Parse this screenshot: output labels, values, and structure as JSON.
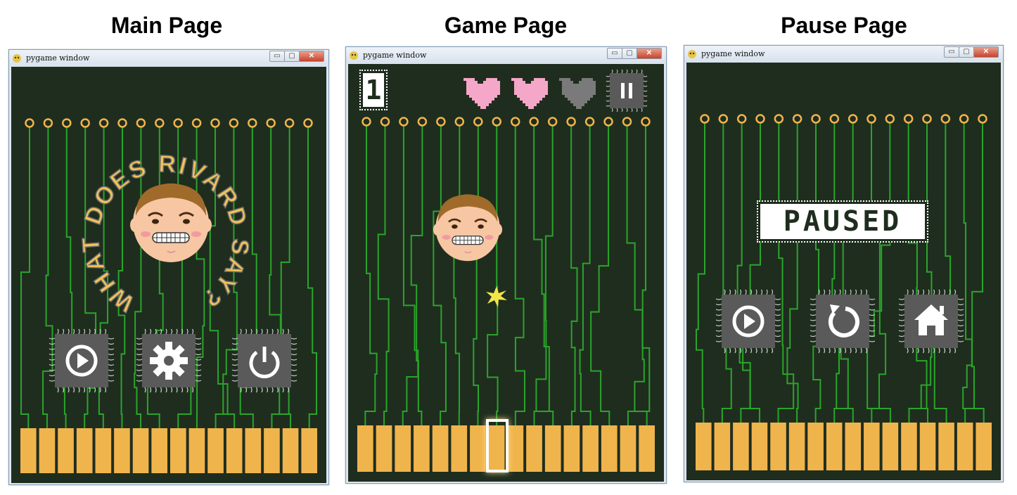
{
  "panels": [
    {
      "heading": "Main Page"
    },
    {
      "heading": "Game Page"
    },
    {
      "heading": "Pause Page"
    }
  ],
  "window": {
    "title": "pygame window",
    "minimize": "▭",
    "maximize": "▢",
    "close": "✕"
  },
  "main": {
    "title_arc": "WHAT DOES RIVARD SAY?",
    "buttons": [
      {
        "name": "play",
        "icon": "play-icon"
      },
      {
        "name": "settings",
        "icon": "gear-icon"
      },
      {
        "name": "quit",
        "icon": "power-icon"
      }
    ]
  },
  "game": {
    "score": "1",
    "lives": [
      {
        "state": "full",
        "color": "#f4a7c8"
      },
      {
        "state": "full",
        "color": "#f4a7c8"
      },
      {
        "state": "empty",
        "color": "#7a7a7a"
      }
    ],
    "pause_icon": "pause-icon",
    "selected_slot": 7
  },
  "pause": {
    "title": "PAUSED",
    "buttons": [
      {
        "name": "resume",
        "icon": "play-icon"
      },
      {
        "name": "restart",
        "icon": "restart-icon"
      },
      {
        "name": "home",
        "icon": "home-icon"
      }
    ]
  },
  "board": {
    "pins": 16,
    "keys": 16,
    "bg": "#1f2d1f",
    "trace": "#2aa52a",
    "gold": "#f0b44c"
  }
}
